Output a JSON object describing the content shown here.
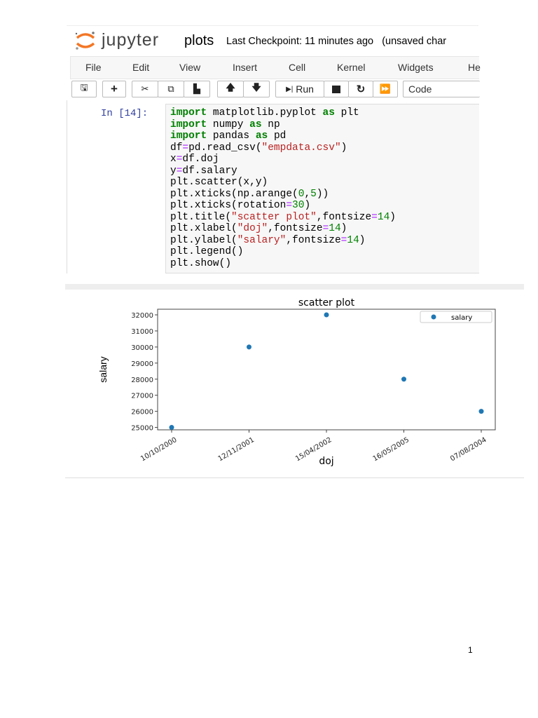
{
  "header": {
    "logo_text": "jupyter",
    "notebook_name": "plots",
    "checkpoint": "Last Checkpoint: 11 minutes ago",
    "unsaved": "(unsaved char"
  },
  "menu": [
    "File",
    "Edit",
    "View",
    "Insert",
    "Cell",
    "Kernel",
    "Widgets",
    "He"
  ],
  "toolbar": {
    "run_label": "Run",
    "cell_type": "Code"
  },
  "cell": {
    "prompt": "In [14]:",
    "code": [
      [
        [
          "import",
          "kw"
        ],
        [
          " matplotlib.pyplot ",
          ""
        ],
        [
          "as",
          "kw"
        ],
        [
          " plt",
          ""
        ]
      ],
      [
        [
          "import",
          "kw"
        ],
        [
          " numpy ",
          ""
        ],
        [
          "as",
          "kw"
        ],
        [
          " np",
          ""
        ]
      ],
      [
        [
          "import",
          "kw"
        ],
        [
          " pandas ",
          ""
        ],
        [
          "as",
          "kw"
        ],
        [
          " pd",
          ""
        ]
      ],
      [
        [
          "df",
          ""
        ],
        [
          "=",
          "op"
        ],
        [
          "pd.read_csv(",
          ""
        ],
        [
          "\"empdata.csv\"",
          "st"
        ],
        [
          ")",
          ""
        ]
      ],
      [
        [
          "x",
          ""
        ],
        [
          "=",
          "op"
        ],
        [
          "df.doj",
          ""
        ]
      ],
      [
        [
          "y",
          ""
        ],
        [
          "=",
          "op"
        ],
        [
          "df.salary",
          ""
        ]
      ],
      [
        [
          "plt.scatter(x,y)",
          ""
        ]
      ],
      [
        [
          "plt.xticks(np.arange(",
          ""
        ],
        [
          "0",
          "nm"
        ],
        [
          ",",
          ""
        ],
        [
          "5",
          "nm"
        ],
        [
          "))",
          ""
        ]
      ],
      [
        [
          "plt.xticks(rotation",
          ""
        ],
        [
          "=",
          "op"
        ],
        [
          "30",
          "nm"
        ],
        [
          ")",
          ""
        ]
      ],
      [
        [
          "plt.title(",
          ""
        ],
        [
          "\"scatter plot\"",
          "st"
        ],
        [
          ",fontsize",
          ""
        ],
        [
          "=",
          "op"
        ],
        [
          "14",
          "nm"
        ],
        [
          ")",
          ""
        ]
      ],
      [
        [
          "plt.xlabel(",
          ""
        ],
        [
          "\"doj\"",
          "st"
        ],
        [
          ",fontsize",
          ""
        ],
        [
          "=",
          "op"
        ],
        [
          "14",
          "nm"
        ],
        [
          ")",
          ""
        ]
      ],
      [
        [
          "plt.ylabel(",
          ""
        ],
        [
          "\"salary\"",
          "st"
        ],
        [
          ",fontsize",
          ""
        ],
        [
          "=",
          "op"
        ],
        [
          "14",
          "nm"
        ],
        [
          ")",
          ""
        ]
      ],
      [
        [
          "plt.legend()",
          ""
        ]
      ],
      [
        [
          "plt.show()",
          ""
        ]
      ]
    ]
  },
  "chart_data": {
    "type": "scatter",
    "title": "scatter plot",
    "xlabel": "doj",
    "ylabel": "salary",
    "categories": [
      "10/10/2000",
      "12/11/2001",
      "15/04/2002",
      "16/05/2005",
      "07/08/2004"
    ],
    "values": [
      25000,
      30000,
      32000,
      28000,
      26000
    ],
    "yticks": [
      "25000",
      "26000",
      "27000",
      "28000",
      "29000",
      "30000",
      "31000",
      "32000"
    ],
    "ylim": [
      24850,
      32350
    ],
    "legend": {
      "label": "salary",
      "placement": "top-right"
    },
    "color": "#1f77b4",
    "xtick_rotation": 30
  },
  "page_number": "1"
}
